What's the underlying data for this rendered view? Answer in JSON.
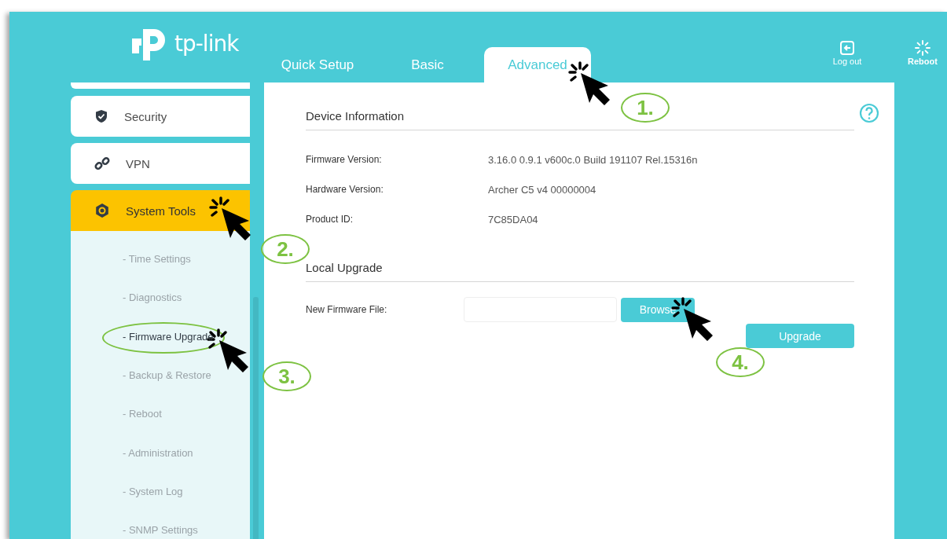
{
  "logo": {
    "text": "tp-link"
  },
  "tabs": [
    {
      "label": "Quick Setup",
      "selected": false
    },
    {
      "label": "Basic",
      "selected": false
    },
    {
      "label": "Advanced",
      "selected": true
    }
  ],
  "header_actions": [
    {
      "kind": "logout",
      "label": "Log out"
    },
    {
      "kind": "reboot",
      "label": "Reboot"
    }
  ],
  "sidebar": {
    "items": [
      {
        "kind": "security",
        "label": "Security",
        "selected": false
      },
      {
        "kind": "vpn",
        "label": "VPN",
        "selected": false
      },
      {
        "kind": "tools",
        "label": "System Tools",
        "selected": true
      }
    ],
    "sub_items": [
      {
        "label": "- Time Settings",
        "selected": false
      },
      {
        "label": "- Diagnostics",
        "selected": false
      },
      {
        "label": "- Firmware Upgrade",
        "selected": true
      },
      {
        "label": "- Backup & Restore",
        "selected": false
      },
      {
        "label": "- Reboot",
        "selected": false
      },
      {
        "label": "- Administration",
        "selected": false
      },
      {
        "label": "- System Log",
        "selected": false
      },
      {
        "label": "- SNMP Settings",
        "selected": false
      }
    ]
  },
  "device_information": {
    "title": "Device Information",
    "rows": [
      {
        "label": "Firmware Version:",
        "value": "3.16.0 0.9.1 v600c.0 Build 191107 Rel.15316n"
      },
      {
        "label": "Hardware Version:",
        "value": "Archer C5 v4 00000004"
      },
      {
        "label": "Product ID:",
        "value": "7C85DA04"
      }
    ]
  },
  "local_upgrade": {
    "title": "Local Upgrade",
    "field_label": "New Firmware File:",
    "browse_button": "Browse",
    "upgrade_button": "Upgrade"
  },
  "callouts": [
    {
      "label": "1."
    },
    {
      "label": "2."
    },
    {
      "label": "3."
    },
    {
      "label": "4."
    }
  ]
}
